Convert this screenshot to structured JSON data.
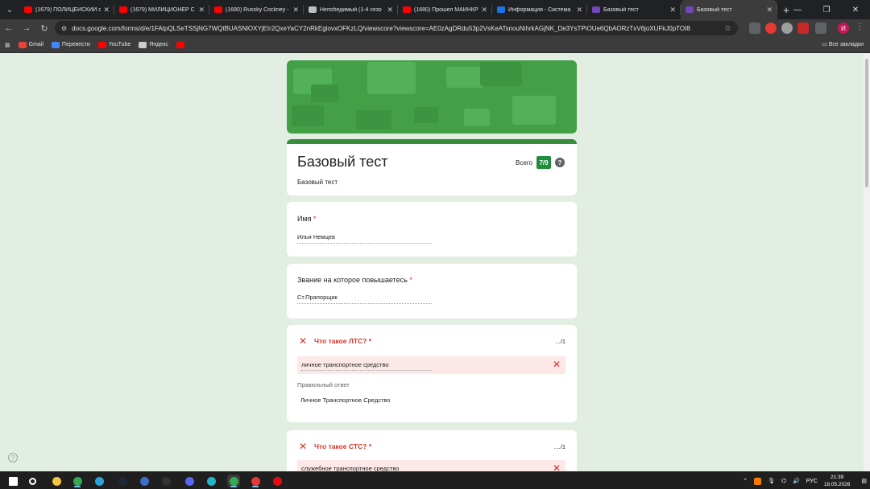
{
  "browser": {
    "tabs": [
      {
        "title": "(1679) ПОЛИЦЕЙСКИЙ с",
        "favicon_color": "#ff0000"
      },
      {
        "title": "(1679) МИЛИЦИОНЕР С",
        "favicon_color": "#ff0000"
      },
      {
        "title": "(1680) Russky Cockney -",
        "favicon_color": "#ff0000"
      },
      {
        "title": "Непобедимый (1-4 сезо",
        "favicon_color": "#bdbdbd"
      },
      {
        "title": "(1680) Прошел МАЙНКР",
        "favicon_color": "#ff0000"
      },
      {
        "title": "Информация - Система",
        "favicon_color": "#1a73e8"
      },
      {
        "title": "Базовый тест",
        "favicon_color": "#7248b9"
      },
      {
        "title": "Базовый тест",
        "favicon_color": "#7248b9",
        "active": true
      }
    ],
    "new_tab": "+",
    "url": "docs.google.com/forms/d/e/1FAIpQLSeTSSjNG7WQtBUASNlOXYjEIr2QxeYaCY2nRkEglovxOFKzLQ/viewscore?viewscore=AE0zAgDRdu53p2VsKeATsnouNihrkAGjNK_De3YsTPiOUe6QbAORzTxV6joXUFkJ0pTOI8",
    "bookmarks": [
      {
        "label": "Gmail",
        "color": "#ea4335"
      },
      {
        "label": "Перевести",
        "color": "#4285f4"
      },
      {
        "label": "YouTube",
        "color": "#ff0000"
      },
      {
        "label": "Яндекс",
        "color": "#cccccc"
      },
      {
        "label": "",
        "color": "#ff0000"
      }
    ],
    "all_bookmarks": "Все закладки",
    "profile_initial": "И"
  },
  "form": {
    "title": "Базовый тест",
    "description": "Базовый тест",
    "score_label": "Всего",
    "score": "7/9",
    "help": "?",
    "questions": [
      {
        "label": "Имя",
        "required": "*",
        "answer": "Илья Немцев"
      },
      {
        "label": "Звание на которое повышаетесь",
        "required": "*",
        "answer": "Ст.Прапорщик"
      }
    ],
    "graded": [
      {
        "label": "Что такое ЛТС? *",
        "points": ".../1",
        "answer": "личное транспортное средство",
        "correct_label": "Правильный ответ",
        "correct_answer": "Личное Транспортное Средство"
      },
      {
        "label": "Что такое СТС? *",
        "points": "..../1",
        "answer": "служебное транспортное средство"
      }
    ]
  },
  "taskbar": {
    "apps": [
      {
        "name": "start-icon",
        "color": "#ffffff"
      },
      {
        "name": "search-icon",
        "color": "#ffffff"
      },
      {
        "name": "file-explorer-icon",
        "color": "#f4c542"
      },
      {
        "name": "chrome-icon",
        "color": "#34a853"
      },
      {
        "name": "telegram-icon",
        "color": "#2aa3dd"
      },
      {
        "name": "steam-icon",
        "color": "#1b2838"
      },
      {
        "name": "app-blue-icon",
        "color": "#3d6ec9"
      },
      {
        "name": "obs-icon",
        "color": "#333333"
      },
      {
        "name": "discord-icon",
        "color": "#5865f2"
      },
      {
        "name": "vpn-icon",
        "color": "#22b5c8"
      },
      {
        "name": "chrome-active-icon",
        "color": "#34a853"
      },
      {
        "name": "media-player-icon",
        "color": "#e53935"
      },
      {
        "name": "netflix-icon",
        "color": "#e50914"
      }
    ],
    "language": "РУС",
    "time": "21:39",
    "date": "18.05.2026"
  }
}
